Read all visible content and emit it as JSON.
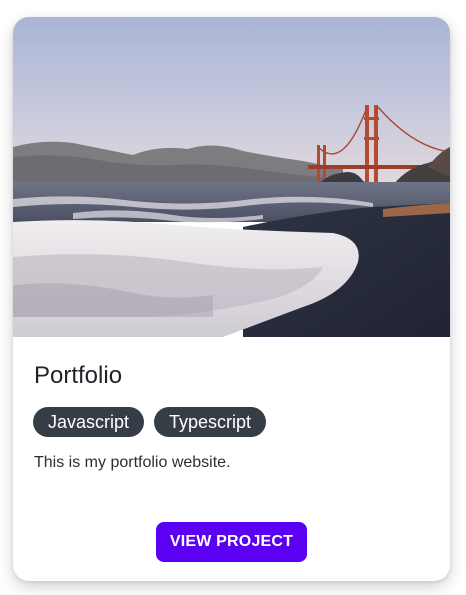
{
  "card": {
    "title": "Portfolio",
    "tags": [
      "Javascript",
      "Typescript"
    ],
    "description": "This is my portfolio website.",
    "button_label": "VIEW PROJECT"
  },
  "colors": {
    "tag_bg": "#363d46",
    "button_bg": "#5b00f2",
    "title_text": "#1f2328"
  }
}
